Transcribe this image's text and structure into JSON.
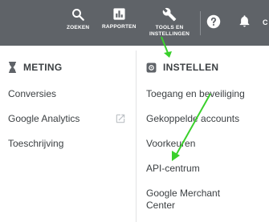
{
  "header": {
    "buttons": [
      {
        "label": "ZOEKEN",
        "icon": "search-icon"
      },
      {
        "label": "RAPPORTEN",
        "icon": "bar-chart-icon"
      },
      {
        "label_line1": "TOOLS EN",
        "label_line2": "INSTELLINGEN",
        "icon": "wrench-icon"
      }
    ],
    "help_icon": "help-icon",
    "notifications_icon": "bell-icon",
    "overflow_letter": "C"
  },
  "menu": {
    "meting": {
      "title": "METING",
      "icon": "hourglass-icon",
      "items": [
        "Conversies",
        "Google Analytics",
        "Toeschrijving"
      ]
    },
    "instellen": {
      "title": "INSTELLEN",
      "icon": "settings-icon",
      "items": [
        "Toegang en beveiliging",
        "Gekoppelde accounts",
        "Voorkeuren",
        "API-centrum"
      ],
      "last_item_line1": "Google Merchant",
      "last_item_line2": "Center"
    }
  },
  "colors": {
    "topbar": "#5f6368",
    "text": "#3c4043",
    "annotation_arrow": "#39d02b"
  }
}
